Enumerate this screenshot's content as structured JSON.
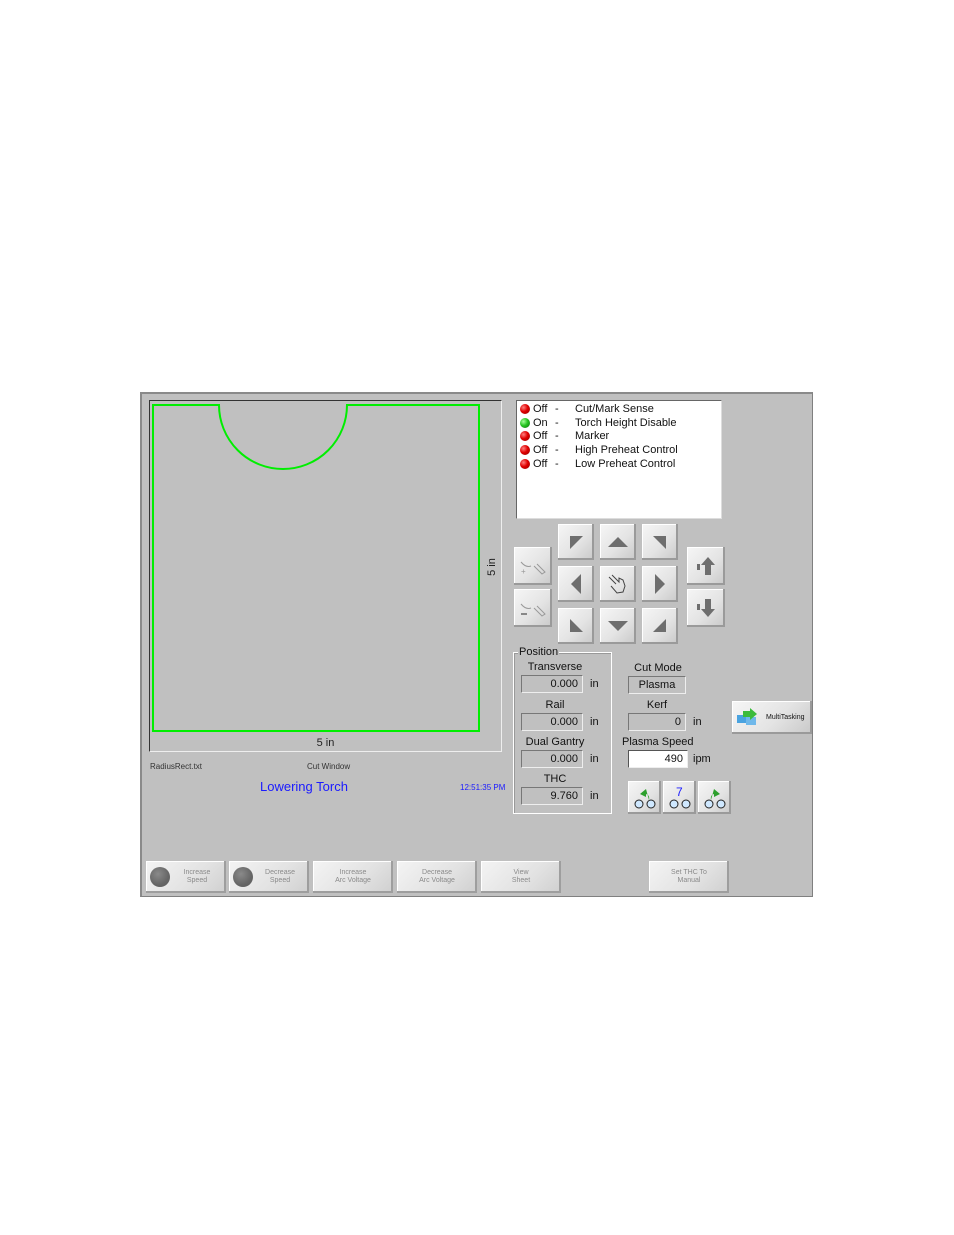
{
  "cut_window": {
    "width_label": "5 in",
    "height_label": "5 in",
    "file_name": "RadiusRect.txt",
    "title": "Cut Window",
    "status_message": "Lowering Torch",
    "clock": "12:51:35 PM",
    "part_color": "#00ee00"
  },
  "io_list": [
    {
      "state": "Off",
      "label": "Cut/Mark Sense",
      "led": "red"
    },
    {
      "state": "On",
      "label": "Torch Height Disable",
      "led": "green"
    },
    {
      "state": "Off",
      "label": "Marker",
      "led": "red"
    },
    {
      "state": "Off",
      "label": "High Preheat Control",
      "led": "red"
    },
    {
      "state": "Off",
      "label": "Low Preheat Control",
      "led": "red"
    }
  ],
  "io_separator": "-",
  "position": {
    "group_label": "Position",
    "unit": "in",
    "axes": [
      {
        "label": "Transverse",
        "value": "0.000"
      },
      {
        "label": "Rail",
        "value": "0.000"
      },
      {
        "label": "Dual Gantry",
        "value": "0.000"
      },
      {
        "label": "THC",
        "value": "9.760"
      }
    ]
  },
  "cut_mode": {
    "label": "Cut Mode",
    "value": "Plasma"
  },
  "kerf": {
    "label": "Kerf",
    "value": "0",
    "unit": "in"
  },
  "plasma_speed": {
    "label": "Plasma Speed",
    "value": "490",
    "unit": "ipm"
  },
  "multitasking": {
    "label": "MultiTasking"
  },
  "trace_buttons": {
    "step_count": "7"
  },
  "function_keys": [
    {
      "label": "Increase\nSpeed",
      "icon": "dial-icon"
    },
    {
      "label": "Decrease\nSpeed",
      "icon": "dial-icon"
    },
    {
      "label": "Increase\nArc Voltage"
    },
    {
      "label": "Decrease\nArc Voltage"
    },
    {
      "label": "View\nSheet"
    },
    {
      "label": "Set THC To\nManual"
    }
  ]
}
